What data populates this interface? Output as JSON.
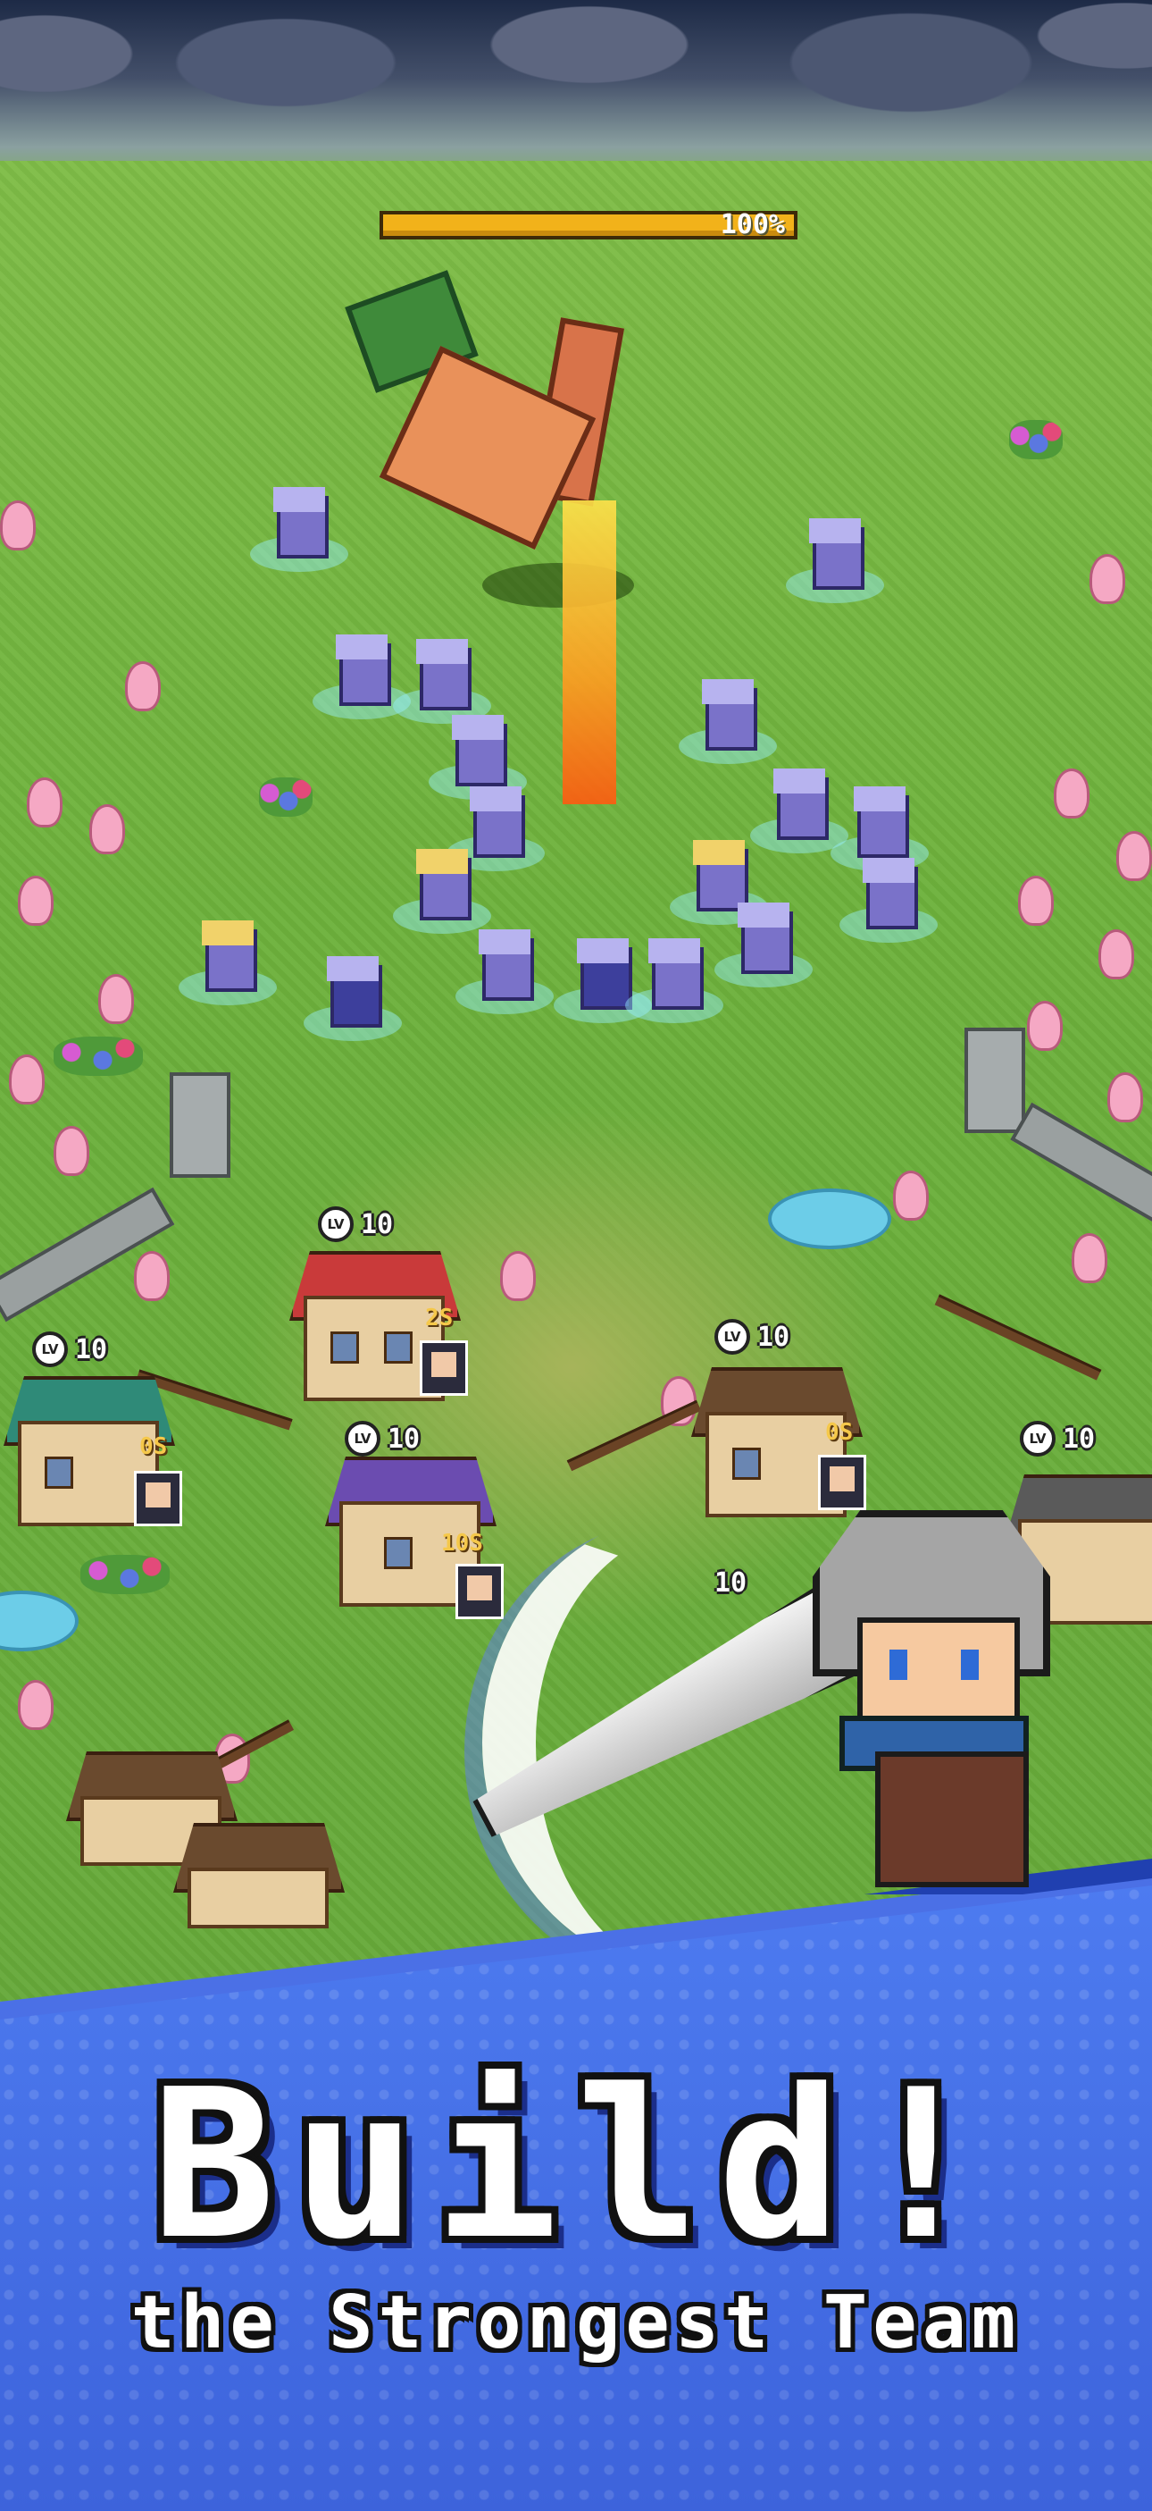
{
  "boss": {
    "hp_percent_label": "100%",
    "hp_fraction": 1.0
  },
  "buildings": [
    {
      "id": "clock-house",
      "lv_icon": "LV",
      "level": "10",
      "timer": "2S",
      "roof_color": "#c93a3a"
    },
    {
      "id": "teal-house",
      "lv_icon": "LV",
      "level": "10",
      "timer": "0S",
      "roof_color": "#2f8a78"
    },
    {
      "id": "purple-house",
      "lv_icon": "LV",
      "level": "10",
      "timer": "10S",
      "roof_color": "#6b4cb0"
    },
    {
      "id": "brown-house",
      "lv_icon": "LV",
      "level": "10",
      "timer": "0S",
      "roof_color": "#6a4a2e"
    },
    {
      "id": "far-right-house",
      "lv_icon": "LV",
      "level": "10",
      "timer": "",
      "roof_color": "#5a5a5a"
    },
    {
      "id": "partly-hidden-house",
      "lv_icon": "",
      "level": "10",
      "timer": "",
      "roof_color": "#777777"
    }
  ],
  "banner": {
    "title": "Build!",
    "subtitle": "the Strongest Team",
    "color": "#4b70e6"
  },
  "icons": [
    "boss-carrot-icon",
    "hero-swordsman-icon",
    "sword-icon",
    "worker-portrait-icon"
  ]
}
